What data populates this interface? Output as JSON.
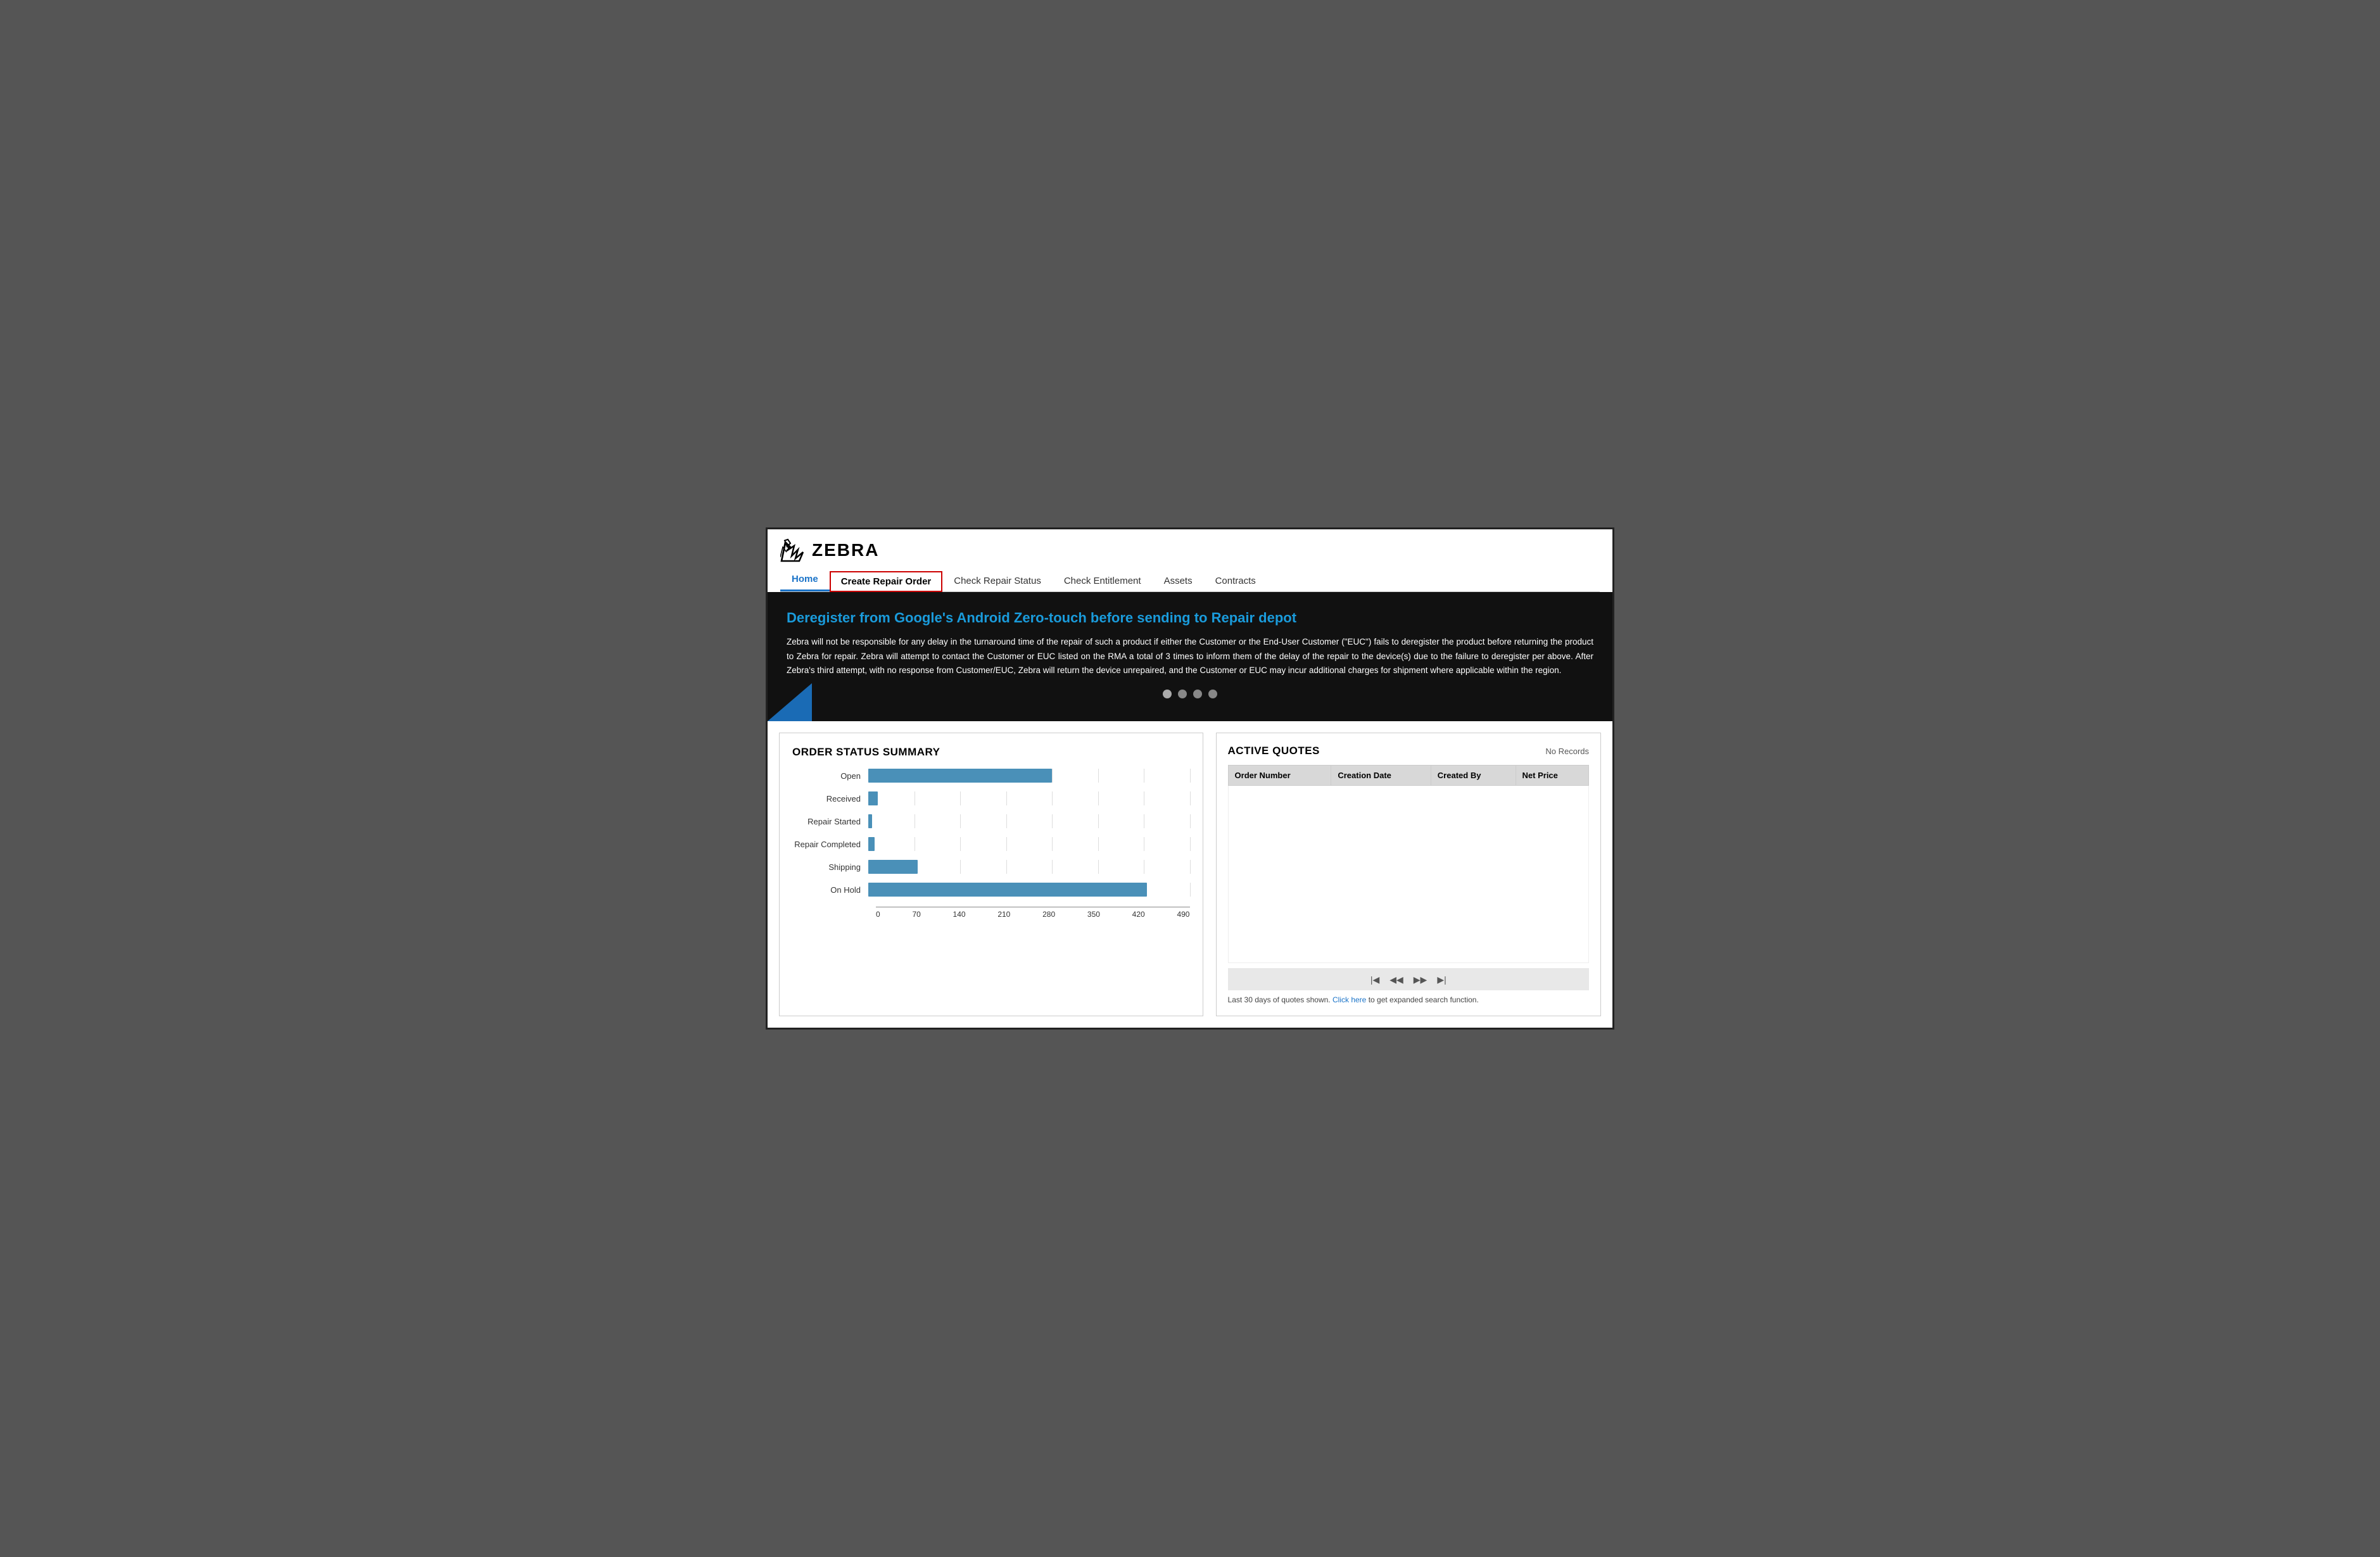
{
  "logo": {
    "text": "ZEBRA"
  },
  "nav": {
    "items": [
      {
        "id": "home",
        "label": "Home",
        "active": true,
        "highlighted": false
      },
      {
        "id": "create-repair-order",
        "label": "Create Repair Order",
        "active": false,
        "highlighted": true
      },
      {
        "id": "check-repair-status",
        "label": "Check Repair Status",
        "active": false,
        "highlighted": false
      },
      {
        "id": "check-entitlement",
        "label": "Check Entitlement",
        "active": false,
        "highlighted": false
      },
      {
        "id": "assets",
        "label": "Assets",
        "active": false,
        "highlighted": false
      },
      {
        "id": "contracts",
        "label": "Contracts",
        "active": false,
        "highlighted": false
      }
    ]
  },
  "banner": {
    "title": "Deregister from Google's Android Zero-touch before sending to Repair depot",
    "body": "Zebra will not be responsible for any delay in the turnaround time of the repair of such a product if either the Customer or the End-User Customer (\"EUC\") fails to deregister the product before returning the product to Zebra for repair. Zebra will attempt to contact the Customer or EUC listed on the RMA a total of 3 times to inform them of the delay of the repair to the device(s) due to the failure to deregister per above. After Zebra's third attempt, with no response from Customer/EUC, Zebra will return the device unrepaired, and the Customer or EUC may incur additional charges for shipment where applicable within the region.",
    "dots": [
      {
        "active": true
      },
      {
        "active": false
      },
      {
        "active": false
      },
      {
        "active": false
      }
    ]
  },
  "order_status": {
    "title": "ORDER STATUS SUMMARY",
    "bars": [
      {
        "label": "Open",
        "value": 280,
        "max": 490
      },
      {
        "label": "Received",
        "value": 14,
        "max": 490
      },
      {
        "label": "Repair Started",
        "value": 6,
        "max": 490
      },
      {
        "label": "Repair Completed",
        "value": 10,
        "max": 490
      },
      {
        "label": "Shipping",
        "value": 75,
        "max": 490
      },
      {
        "label": "On Hold",
        "value": 425,
        "max": 490
      }
    ],
    "x_axis": [
      "0",
      "70",
      "140",
      "210",
      "280",
      "350",
      "420",
      "490"
    ]
  },
  "active_quotes": {
    "title": "ACTIVE QUOTES",
    "no_records": "No Records",
    "columns": [
      "Order Number",
      "Creation Date",
      "Created By",
      "Net Price"
    ],
    "footer_text": "Last 30 days of quotes shown.",
    "footer_link": "Click here",
    "footer_suffix": "to get expanded search function.",
    "pagination": {
      "first": "|◀",
      "prev": "◀◀",
      "next": "▶▶",
      "last": "▶|"
    }
  }
}
